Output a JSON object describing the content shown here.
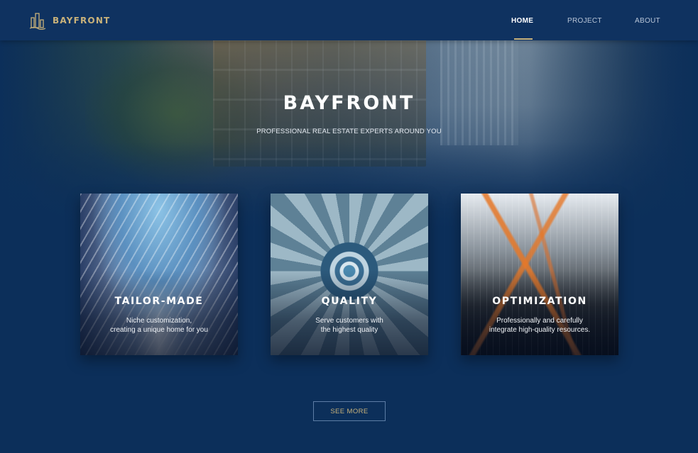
{
  "navbar": {
    "brand": {
      "name": "BAYFRONT",
      "icon": "buildings-logo-icon",
      "color": "#c9b27a"
    },
    "links": [
      {
        "label": "HOME",
        "active": true
      },
      {
        "label": "PROJECT",
        "active": false
      },
      {
        "label": "ABOUT",
        "active": false
      }
    ]
  },
  "hero": {
    "title": "BAYFRONT",
    "subtitle": "PROFESSIONAL REAL ESTATE EXPERTS AROUND YOU"
  },
  "cards": [
    {
      "title": "TAILOR-MADE",
      "description_lines": [
        "Niche customization,",
        "creating a unique home for you"
      ]
    },
    {
      "title": "QUALITY",
      "description_lines": [
        "Serve customers with",
        "the highest quality"
      ]
    },
    {
      "title": "OPTIMIZATION",
      "description_lines": [
        "Professionally and carefully",
        "integrate high-quality resources."
      ]
    }
  ],
  "cta": {
    "label": "SEE MORE"
  },
  "colors": {
    "background": "#0c2f5a",
    "navbar": "#0f3260",
    "accent_gold": "#c9b27a"
  }
}
